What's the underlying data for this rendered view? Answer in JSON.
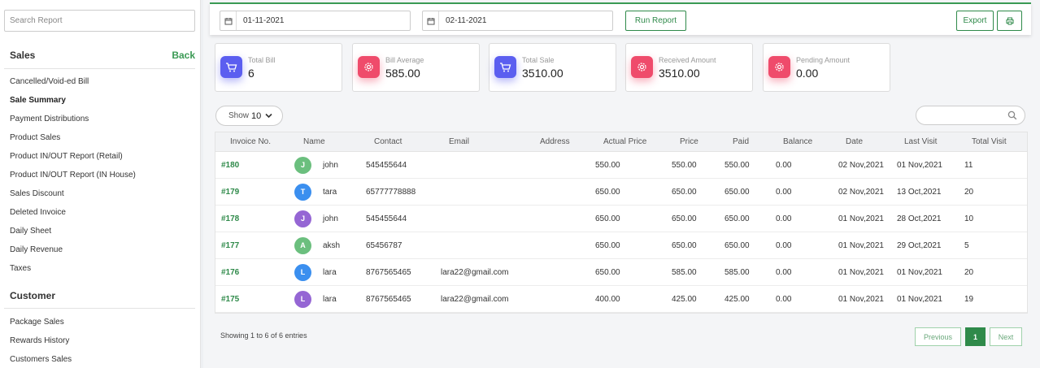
{
  "sidebar": {
    "search_placeholder": "Search Report",
    "sales_title": "Sales",
    "back_label": "Back",
    "sales_items": [
      "Cancelled/Void-ed Bill",
      "Sale Summary",
      "Payment Distributions",
      "Product Sales",
      "Product IN/OUT Report (Retail)",
      "Product IN/OUT Report (IN House)",
      "Sales Discount",
      "Deleted Invoice",
      "Daily Sheet",
      "Daily Revenue",
      "Taxes"
    ],
    "active_item": "Sale Summary",
    "customer_title": "Customer",
    "customer_items": [
      "Package Sales",
      "Rewards History",
      "Customers Sales"
    ]
  },
  "toolbar": {
    "from_date": "01-11-2021",
    "to_date": "02-11-2021",
    "run_label": "Run Report",
    "export_label": "Export"
  },
  "stats": [
    {
      "label": "Total Bill",
      "value": "6",
      "icon": "cart-icon",
      "color": "#5b5ef0"
    },
    {
      "label": "Bill Average",
      "value": "585.00",
      "icon": "gear-icon",
      "color": "#ef4b6b"
    },
    {
      "label": "Total Sale",
      "value": "3510.00",
      "icon": "cart-icon",
      "color": "#5b5ef0"
    },
    {
      "label": "Received Amount",
      "value": "3510.00",
      "icon": "gear-icon",
      "color": "#ef4b6b"
    },
    {
      "label": "Pending Amount",
      "value": "0.00",
      "icon": "gear-icon",
      "color": "#ef4b6b"
    }
  ],
  "controls": {
    "show_label": "Show",
    "show_value": "10",
    "search_value": ""
  },
  "table": {
    "headers": [
      "Invoice No.",
      "Name",
      "Contact",
      "Email",
      "Address",
      "Actual Price",
      "Price",
      "Paid",
      "Balance",
      "Date",
      "Last Visit",
      "Total Visit"
    ],
    "rows": [
      {
        "invoice": "#180",
        "initial": "J",
        "avatar_color": "#6bbf7e",
        "name": "john",
        "contact": "545455644",
        "email": "",
        "address": "",
        "actual": "550.00",
        "price": "550.00",
        "paid": "550.00",
        "balance": "0.00",
        "date": "02 Nov,2021",
        "last": "01 Nov,2021",
        "visits": "11"
      },
      {
        "invoice": "#179",
        "initial": "T",
        "avatar_color": "#3b8fef",
        "name": "tara",
        "contact": "65777778888",
        "email": "",
        "address": "",
        "actual": "650.00",
        "price": "650.00",
        "paid": "650.00",
        "balance": "0.00",
        "date": "02 Nov,2021",
        "last": "13 Oct,2021",
        "visits": "20"
      },
      {
        "invoice": "#178",
        "initial": "J",
        "avatar_color": "#9566d4",
        "name": "john",
        "contact": "545455644",
        "email": "",
        "address": "",
        "actual": "650.00",
        "price": "650.00",
        "paid": "650.00",
        "balance": "0.00",
        "date": "01 Nov,2021",
        "last": "28 Oct,2021",
        "visits": "10"
      },
      {
        "invoice": "#177",
        "initial": "A",
        "avatar_color": "#6bbf7e",
        "name": "aksh",
        "contact": "65456787",
        "email": "",
        "address": "",
        "actual": "650.00",
        "price": "650.00",
        "paid": "650.00",
        "balance": "0.00",
        "date": "01 Nov,2021",
        "last": "29 Oct,2021",
        "visits": "5"
      },
      {
        "invoice": "#176",
        "initial": "L",
        "avatar_color": "#3b8fef",
        "name": "lara",
        "contact": "8767565465",
        "email": "lara22@gmail.com",
        "address": "",
        "actual": "650.00",
        "price": "585.00",
        "paid": "585.00",
        "balance": "0.00",
        "date": "01 Nov,2021",
        "last": "01 Nov,2021",
        "visits": "20"
      },
      {
        "invoice": "#175",
        "initial": "L",
        "avatar_color": "#9566d4",
        "name": "lara",
        "contact": "8767565465",
        "email": "lara22@gmail.com",
        "address": "",
        "actual": "400.00",
        "price": "425.00",
        "paid": "425.00",
        "balance": "0.00",
        "date": "01 Nov,2021",
        "last": "01 Nov,2021",
        "visits": "19"
      }
    ]
  },
  "footer": {
    "showing": "Showing 1 to 6 of 6 entries",
    "prev_label": "Previous",
    "page": "1",
    "next_label": "Next"
  }
}
